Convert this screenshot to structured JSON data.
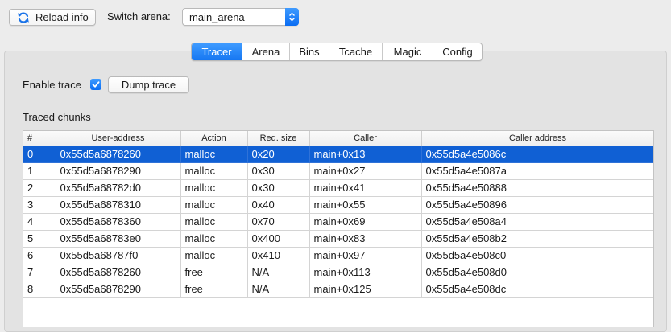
{
  "toolbar": {
    "reload_label": "Reload info",
    "switch_label": "Switch arena:",
    "arena_selected": "main_arena"
  },
  "tabs": [
    "Tracer",
    "Arena",
    "Bins",
    "Tcache",
    "Magic",
    "Config"
  ],
  "active_tab": "Tracer",
  "tracer": {
    "enable_label": "Enable trace",
    "enable_checked": true,
    "dump_label": "Dump trace",
    "chunks_label": "Traced chunks",
    "columns": [
      "#",
      "User-address",
      "Action",
      "Req. size",
      "Caller",
      "Caller address"
    ],
    "selected_row": 0,
    "rows": [
      [
        "0",
        "0x55d5a6878260",
        "malloc",
        "0x20",
        "main+0x13",
        "0x55d5a4e5086c"
      ],
      [
        "1",
        "0x55d5a6878290",
        "malloc",
        "0x30",
        "main+0x27",
        "0x55d5a4e5087a"
      ],
      [
        "2",
        "0x55d5a68782d0",
        "malloc",
        "0x30",
        "main+0x41",
        "0x55d5a4e50888"
      ],
      [
        "3",
        "0x55d5a6878310",
        "malloc",
        "0x40",
        "main+0x55",
        "0x55d5a4e50896"
      ],
      [
        "4",
        "0x55d5a6878360",
        "malloc",
        "0x70",
        "main+0x69",
        "0x55d5a4e508a4"
      ],
      [
        "5",
        "0x55d5a68783e0",
        "malloc",
        "0x400",
        "main+0x83",
        "0x55d5a4e508b2"
      ],
      [
        "6",
        "0x55d5a68787f0",
        "malloc",
        "0x410",
        "main+0x97",
        "0x55d5a4e508c0"
      ],
      [
        "7",
        "0x55d5a6878260",
        "free",
        "N/A",
        "main+0x113",
        "0x55d5a4e508d0"
      ],
      [
        "8",
        "0x55d5a6878290",
        "free",
        "N/A",
        "main+0x125",
        "0x55d5a4e508dc"
      ]
    ]
  },
  "colors": {
    "accent": "#1677f2",
    "selection": "#1060d4",
    "window_bg": "#ececec"
  },
  "icons": {
    "reload": "refresh-arrows-icon",
    "select": "chevron-updown-icon",
    "check": "checkmark-icon"
  }
}
